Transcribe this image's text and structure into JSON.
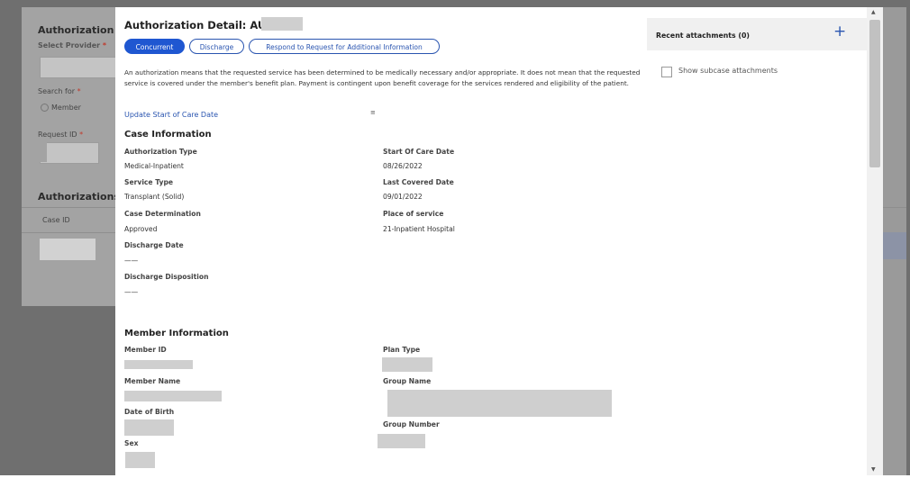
{
  "background": {
    "heading_auth": "Authorization",
    "select_provider_label": "Select Provider",
    "search_for_label": "Search for",
    "member_radio_label": "Member",
    "request_id_label": "Request ID",
    "authorizations_heading": "Authorizations (",
    "case_id_header": "Case ID"
  },
  "modal": {
    "title": "Authorization Detail: AUTH-",
    "buttons": {
      "concurrent": "Concurrent",
      "discharge": "Discharge",
      "respond": "Respond to Request for Additional Information"
    },
    "disclaimer": "An authorization means that the requested service has been determined to be medically necessary and/or appropriate.  It does not mean that the requested service is covered under the member's benefit plan.  Payment is contingent upon benefit coverage for the services rendered and eligibility of the patient.",
    "update_link": "Update Start of Care Date",
    "tiny_mark": "≡",
    "case_info": {
      "title": "Case Information",
      "auth_type_label": "Authorization Type",
      "auth_type_value": "Medical-Inpatient",
      "service_type_label": "Service Type",
      "service_type_value": "Transplant (Solid)",
      "case_determination_label": "Case Determination",
      "case_determination_value": "Approved",
      "discharge_date_label": "Discharge Date",
      "discharge_date_value": "——",
      "discharge_disposition_label": "Discharge Disposition",
      "discharge_disposition_value": "——",
      "start_of_care_label": "Start Of Care Date",
      "start_of_care_value": "08/26/2022",
      "last_covered_label": "Last Covered Date",
      "last_covered_value": "09/01/2022",
      "place_of_service_label": "Place of service",
      "place_of_service_value": "21-Inpatient Hospital"
    },
    "member_info": {
      "title": "Member Information",
      "member_id_label": "Member ID",
      "member_name_label": "Member Name",
      "dob_label": "Date of Birth",
      "sex_label": "Sex",
      "plan_type_label": "Plan Type",
      "group_name_label": "Group Name",
      "group_number_label": "Group Number"
    }
  },
  "side_panel": {
    "title": "Recent attachments (0)",
    "add_icon": "plus-icon",
    "show_subcase_label": "Show subcase attachments",
    "show_subcase_checked": false
  },
  "colors": {
    "primary": "#1f57d1",
    "link": "#2a55b0",
    "overlay": "#6f6f6f"
  }
}
